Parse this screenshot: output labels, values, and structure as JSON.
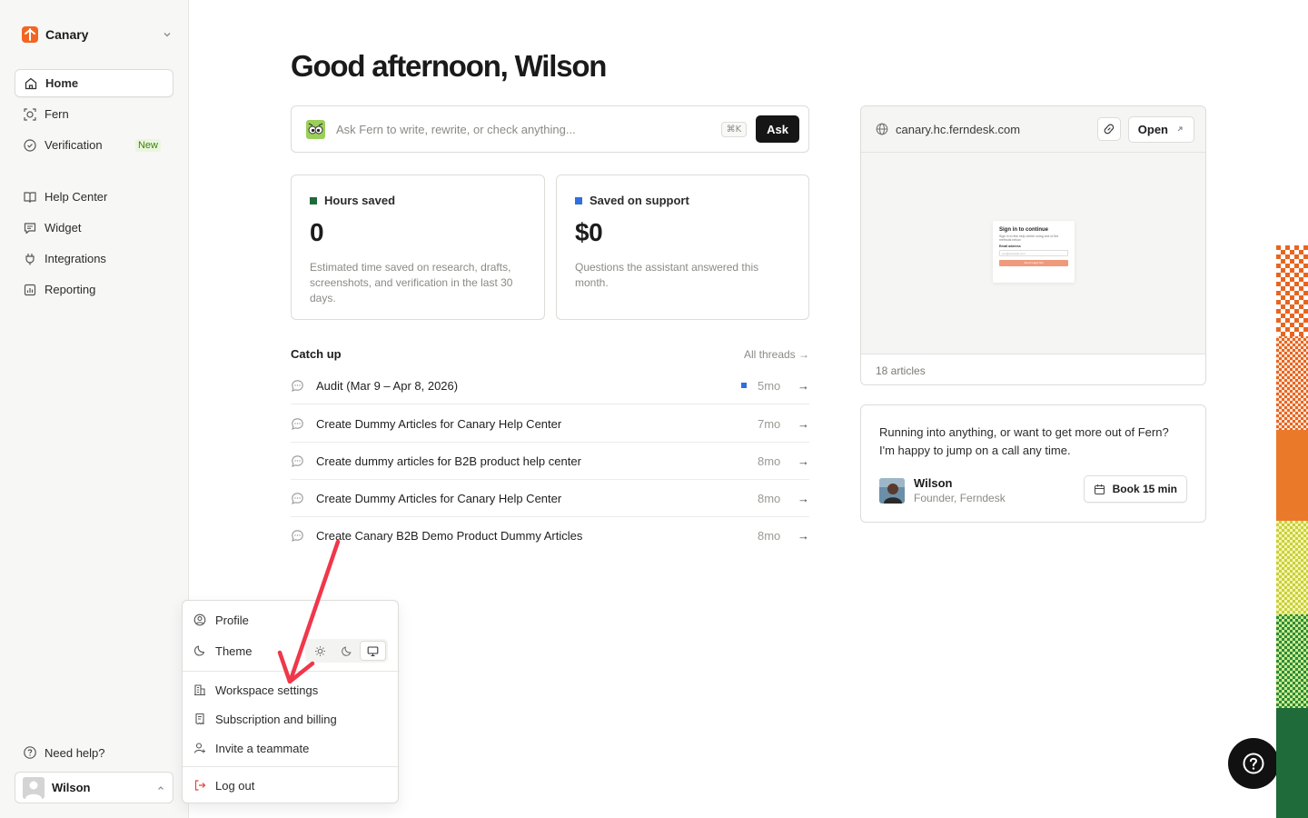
{
  "workspace": {
    "name": "Canary",
    "logo_color": "#f26522"
  },
  "sidebar": {
    "items": [
      {
        "label": "Home",
        "icon": "home-icon"
      },
      {
        "label": "Fern",
        "icon": "scan-face-icon"
      },
      {
        "label": "Verification",
        "icon": "check-circle-icon",
        "badge": "New"
      },
      {
        "label": "Help Center",
        "icon": "book-icon"
      },
      {
        "label": "Widget",
        "icon": "chat-square-icon"
      },
      {
        "label": "Integrations",
        "icon": "plug-icon"
      },
      {
        "label": "Reporting",
        "icon": "chart-icon"
      }
    ],
    "need_help": "Need help?",
    "user_name": "Wilson"
  },
  "main": {
    "greeting": "Good afternoon, Wilson",
    "ask": {
      "placeholder": "Ask Fern to write, rewrite, or check anything...",
      "shortcut": "⌘K",
      "button": "Ask"
    },
    "stats": [
      {
        "label": "Hours saved",
        "value": "0",
        "color": "#1e6b3a",
        "description": "Estimated time saved on research, drafts, screenshots, and verification in the last 30 days."
      },
      {
        "label": "Saved on support",
        "value": "$0",
        "color": "#2f6fe0",
        "description": "Questions the assistant answered this month."
      }
    ],
    "catch_up": {
      "title": "Catch up",
      "all_threads": "All threads →",
      "threads": [
        {
          "title": "Audit (Mar 9 – Apr 8, 2026)",
          "age": "5mo",
          "unread": true
        },
        {
          "title": "Create Dummy Articles for Canary Help Center",
          "age": "7mo",
          "unread": false
        },
        {
          "title": "Create dummy articles for B2B product help center",
          "age": "8mo",
          "unread": false
        },
        {
          "title": "Create Dummy Articles for Canary Help Center",
          "age": "8mo",
          "unread": false
        },
        {
          "title": "Create Canary B2B Demo Product Dummy Articles",
          "age": "8mo",
          "unread": false
        }
      ]
    }
  },
  "site_card": {
    "url": "canary.hc.ferndesk.com",
    "open_label": "Open",
    "articles": "18 articles",
    "preview": {
      "heading": "Sign in to continue",
      "text": "Sign in to this help center using one of the methods below.",
      "email_label": "Email address",
      "email_placeholder": "you@example.com",
      "button": "Send magic link"
    }
  },
  "call_card": {
    "message": "Running into anything, or want to get more out of Fern? I'm happy to jump on a call any time.",
    "person_name": "Wilson",
    "person_role": "Founder, Ferndesk",
    "book_label": "Book 15 min"
  },
  "user_menu": {
    "profile": "Profile",
    "theme": "Theme",
    "theme_options": [
      "light",
      "dark",
      "system"
    ],
    "theme_selected": "system",
    "workspace_settings": "Workspace settings",
    "billing": "Subscription and billing",
    "invite": "Invite a teammate",
    "logout": "Log out"
  },
  "colors": {
    "accent_dark": "#161616",
    "annotation_arrow": "#f0374a",
    "logout_icon": "#e0463a"
  }
}
